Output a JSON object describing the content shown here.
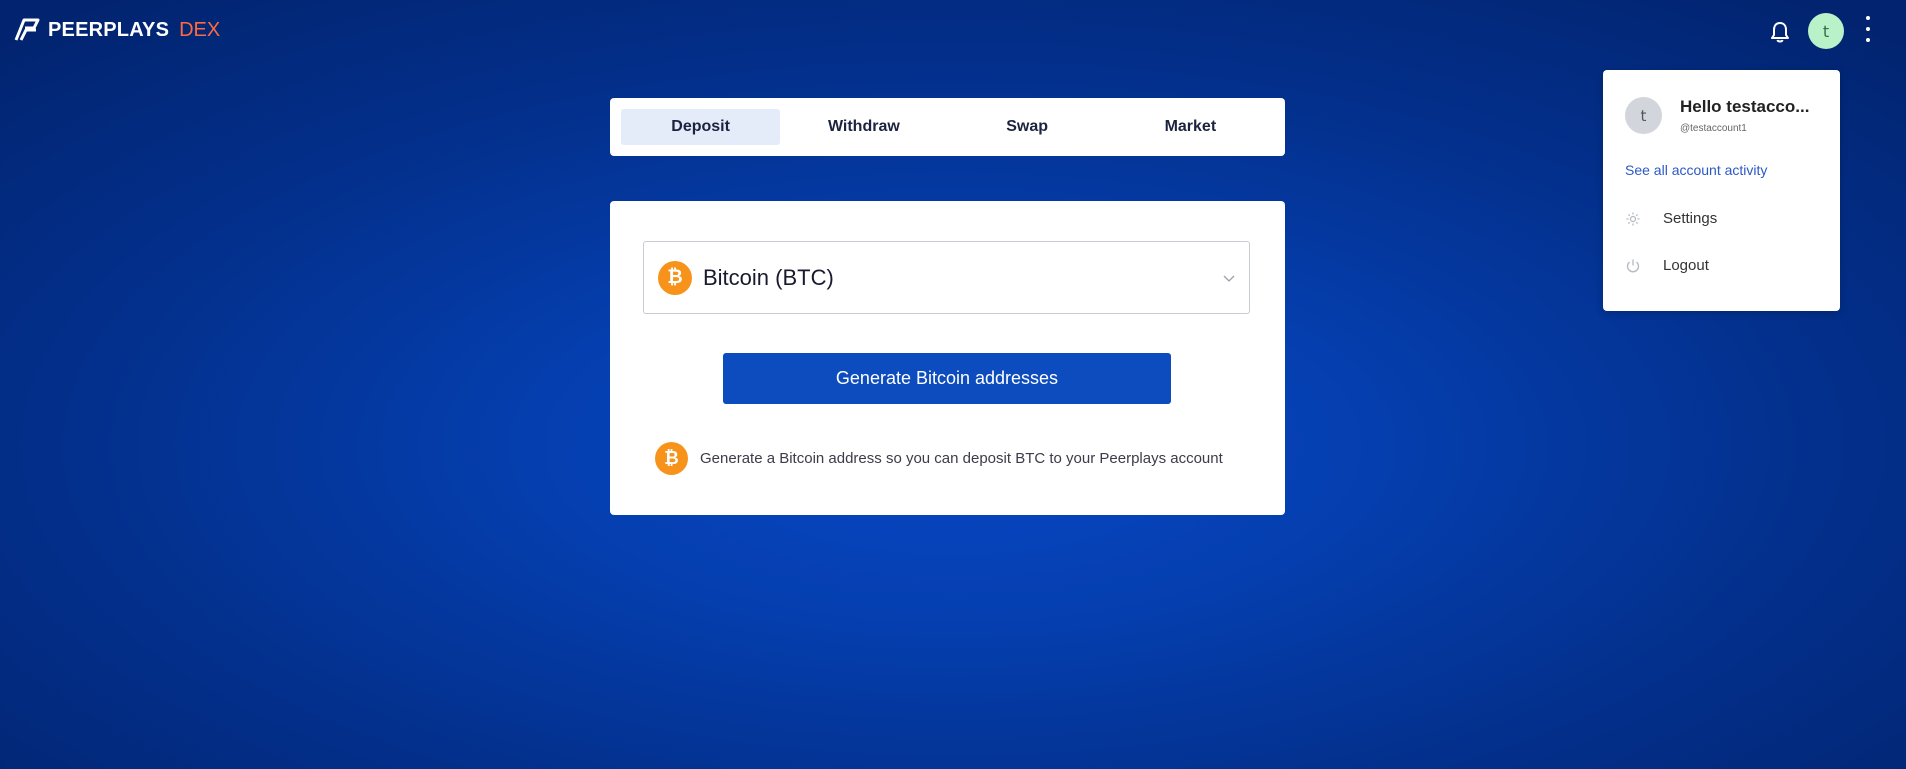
{
  "header": {
    "brand": "PEERPLAYS",
    "brand_suffix": "DEX",
    "brand_suffix_color": "#ff6a3d",
    "avatar_initial": "t",
    "bell_icon": "bell-icon",
    "menu_icon": "kebab-menu-icon"
  },
  "tabs": [
    {
      "label": "Deposit",
      "active": true
    },
    {
      "label": "Withdraw",
      "active": false
    },
    {
      "label": "Swap",
      "active": false
    },
    {
      "label": "Market",
      "active": false
    }
  ],
  "deposit": {
    "asset_select_value": "Bitcoin (BTC)",
    "asset_icon_glyph": "₿",
    "generate_button": "Generate Bitcoin addresses",
    "info_text": "Generate a Bitcoin address so you can deposit BTC to your Peerplays account"
  },
  "account_menu": {
    "avatar_initial": "t",
    "greeting": "Hello testacco...",
    "handle": "@testaccount1",
    "activity_link": "See all account activity",
    "settings_label": "Settings",
    "logout_label": "Logout"
  },
  "colors": {
    "accent": "#0c4cbf",
    "bitcoin": "#f7931a",
    "link": "#2c59c5"
  }
}
